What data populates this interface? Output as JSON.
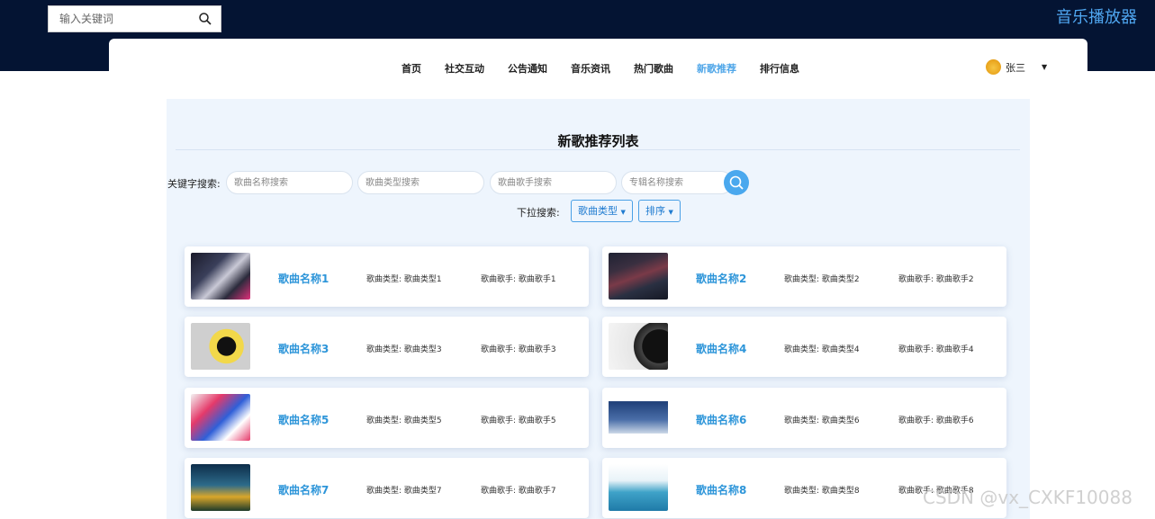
{
  "header": {
    "search_placeholder": "输入关键词",
    "app_title": "音乐播放器"
  },
  "nav": {
    "items": [
      {
        "label": "首页"
      },
      {
        "label": "社交互动"
      },
      {
        "label": "公告通知"
      },
      {
        "label": "音乐资讯"
      },
      {
        "label": "热门歌曲"
      },
      {
        "label": "新歌推荐",
        "active": true
      },
      {
        "label": "排行信息"
      }
    ],
    "user_name": "张三",
    "caret": "▼"
  },
  "panel": {
    "title": "新歌推荐列表",
    "keyword_label": "关键字搜索:",
    "inputs": {
      "song_name": "歌曲名称搜索",
      "song_type": "歌曲类型搜索",
      "singer": "歌曲歌手搜索",
      "album": "专辑名称搜索"
    },
    "dropdown_label": "下拉搜索:",
    "dropdowns": {
      "type": "歌曲类型",
      "sort": "排序"
    }
  },
  "songs": [
    {
      "name": "歌曲名称1",
      "type": "歌曲类型: 歌曲类型1",
      "singer": "歌曲歌手: 歌曲歌手1"
    },
    {
      "name": "歌曲名称2",
      "type": "歌曲类型: 歌曲类型2",
      "singer": "歌曲歌手: 歌曲歌手2"
    },
    {
      "name": "歌曲名称3",
      "type": "歌曲类型: 歌曲类型3",
      "singer": "歌曲歌手: 歌曲歌手3"
    },
    {
      "name": "歌曲名称4",
      "type": "歌曲类型: 歌曲类型4",
      "singer": "歌曲歌手: 歌曲歌手4"
    },
    {
      "name": "歌曲名称5",
      "type": "歌曲类型: 歌曲类型5",
      "singer": "歌曲歌手: 歌曲歌手5"
    },
    {
      "name": "歌曲名称6",
      "type": "歌曲类型: 歌曲类型6",
      "singer": "歌曲歌手: 歌曲歌手6"
    },
    {
      "name": "歌曲名称7",
      "type": "歌曲类型: 歌曲类型7",
      "singer": "歌曲歌手: 歌曲歌手7"
    },
    {
      "name": "歌曲名称8",
      "type": "歌曲类型: 歌曲类型8",
      "singer": "歌曲歌手: 歌曲歌手8"
    }
  ],
  "watermark": "CSDN @vx_CXKF10088"
}
